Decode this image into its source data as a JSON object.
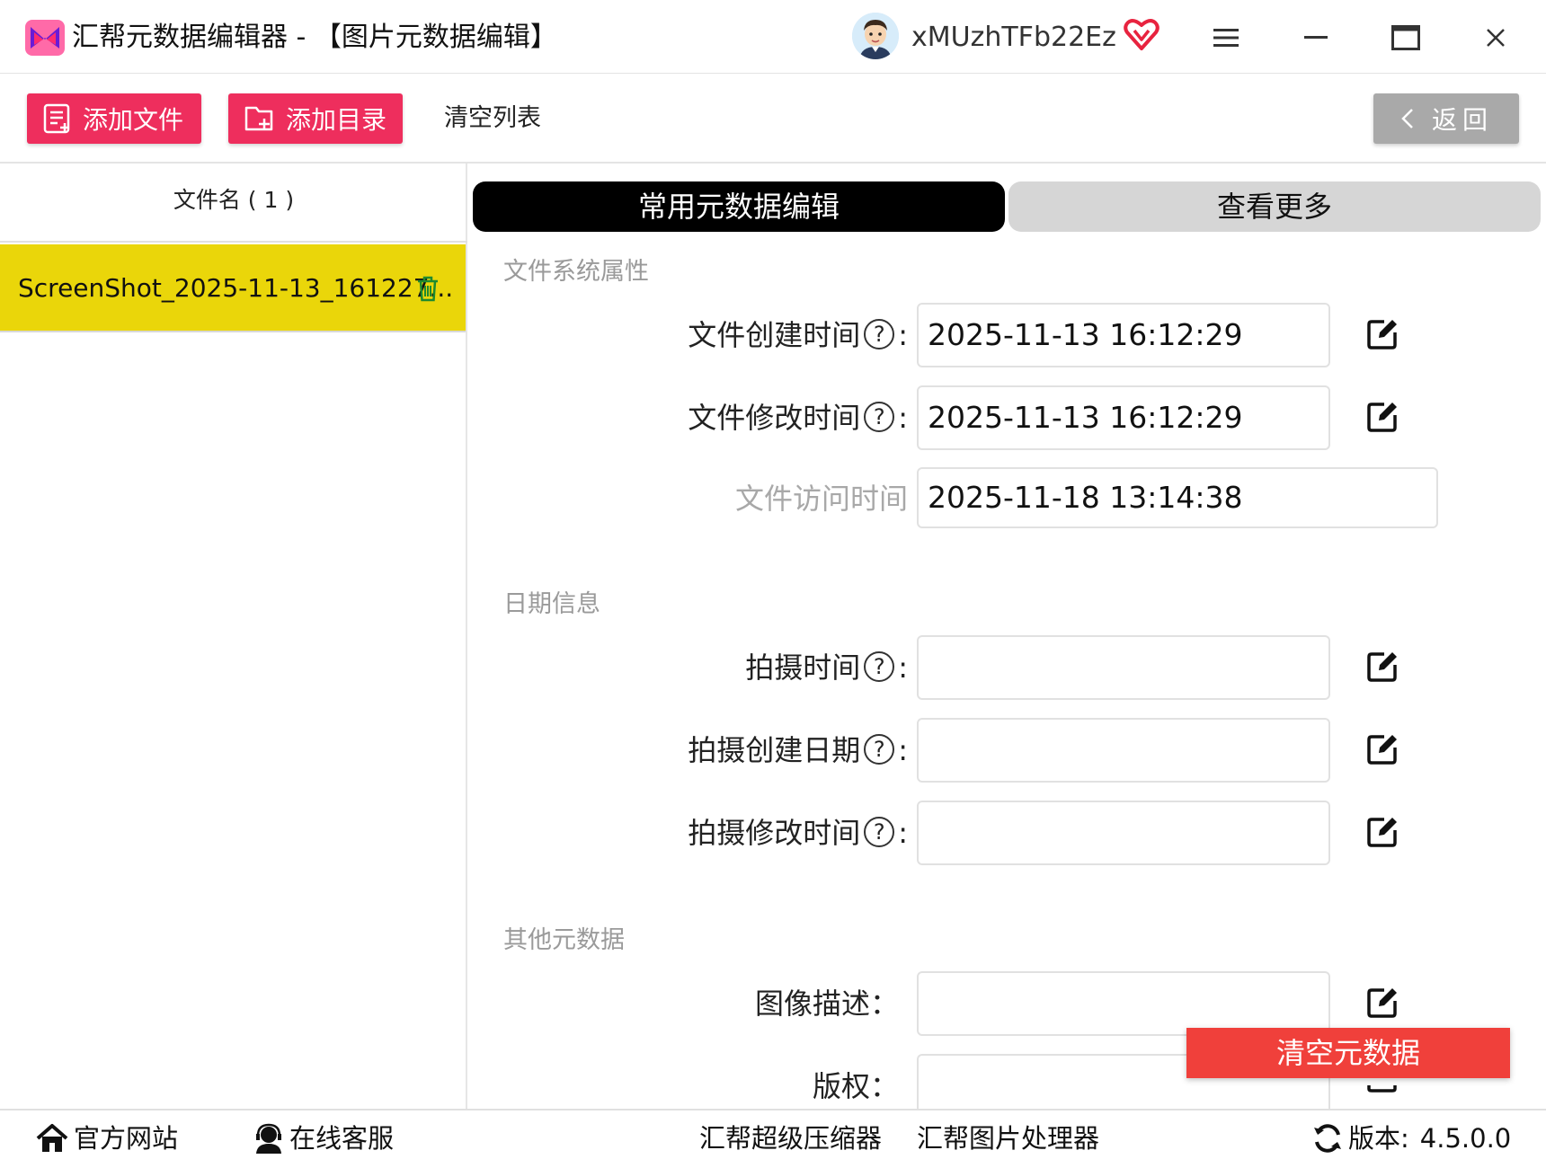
{
  "window": {
    "title": "汇帮元数据编辑器 - 【图片元数据编辑】",
    "username": "xMUzhTFb22Ez",
    "icons": [
      "app-logo-icon",
      "avatar",
      "vip-heart-icon",
      "menu-icon",
      "minimize-icon",
      "maximize-icon",
      "close-icon"
    ]
  },
  "toolbar": {
    "add_file": "添加文件",
    "add_dir": "添加目录",
    "clear_list": "清空列表",
    "back": "返回"
  },
  "file_list": {
    "header": "文件名 ( 1 )",
    "items": [
      {
        "name": "ScreenShot_2025-11-13_161227..."
      }
    ]
  },
  "tabs": {
    "active": "常用元数据编辑",
    "more": "查看更多"
  },
  "sections": {
    "fs": {
      "title": "文件系统属性",
      "created_label": "文件创建时间",
      "created_value": "2025-11-13 16:12:29",
      "modified_label": "文件修改时间",
      "modified_value": "2025-11-13 16:12:29",
      "accessed_label": "文件访问时间",
      "accessed_value": "2025-11-18 13:14:38"
    },
    "date": {
      "title": "日期信息",
      "shot_label": "拍摄时间",
      "shot_value": "",
      "shot_created_label": "拍摄创建日期",
      "shot_created_value": "",
      "shot_modified_label": "拍摄修改时间",
      "shot_modified_value": ""
    },
    "other": {
      "title": "其他元数据",
      "desc_label": "图像描述",
      "desc_value": "",
      "copyright_label": "版权",
      "copyright_value": ""
    }
  },
  "help_glyph": "?",
  "colon": ":",
  "colon_wide": "：",
  "clear_meta": "清空元数据",
  "bottom": {
    "website": "官方网站",
    "support": "在线客服",
    "compressor": "汇帮超级压缩器",
    "image_tool": "汇帮图片处理器",
    "version_label": "版本:",
    "version": "4.5.0.0"
  },
  "colors": {
    "pink_button": "#ee2e5d",
    "selected_row": "#ead60a",
    "clear_button": "#f0403b",
    "vip_red": "#e8233f"
  }
}
